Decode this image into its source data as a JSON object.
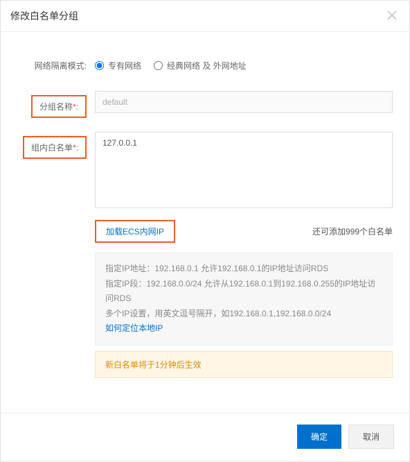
{
  "dialog": {
    "title": "修改白名单分组"
  },
  "form": {
    "networkMode": {
      "label": "网络隔离模式:",
      "options": [
        {
          "label": "专有网络",
          "checked": true
        },
        {
          "label": "经典网络 及 外网地址",
          "checked": false
        }
      ]
    },
    "groupName": {
      "label": "分组名称",
      "value": "default"
    },
    "whitelist": {
      "label": "组内白名单",
      "value": "127.0.0.1"
    },
    "ecsLink": "加载ECS内网IP",
    "remainText": "还可添加999个白名单",
    "help": {
      "line1": "指定IP地址：192.168.0.1 允许192.168.0.1的IP地址访问RDS",
      "line2": "指定IP段：192.168.0.0/24 允许从192.168.0.1到192.168.0.255的IP地址访问RDS",
      "line3": "多个IP设置，用英文逗号隔开，如192.168.0.1,192.168.0.0/24",
      "localIpLink": "如何定位本地IP"
    },
    "warnText": "新白名单将于1分钟后生效"
  },
  "footer": {
    "ok": "确定",
    "cancel": "取消"
  }
}
